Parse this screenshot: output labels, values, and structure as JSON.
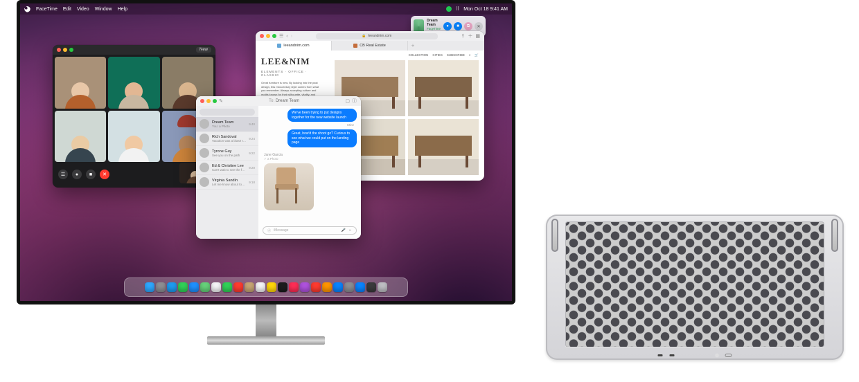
{
  "menubar": {
    "app": "FaceTime",
    "items": [
      "Edit",
      "Video",
      "Window",
      "Help"
    ],
    "clock": "Mon Oct 18  9:41 AM"
  },
  "control_banner": {
    "title": "Dream Team",
    "subtitle": "FaceTime Audio…",
    "buttons": {
      "mic": "mic",
      "video": "video",
      "share": "share",
      "leave": "leave"
    }
  },
  "facetime": {
    "new_label": "New",
    "controls": {
      "mute": "mute",
      "camera": "camera",
      "end": "end",
      "sidebar": "sidebar"
    },
    "tiles": [
      {
        "bg": "#d9c2a3",
        "shirt": "#b4602c",
        "head": "#e8c7a8",
        "wall": "#a99178"
      },
      {
        "bg": "#0f6f57",
        "shirt": "#c8b7a0",
        "head": "#e2b793",
        "wall": "#0f6f57"
      },
      {
        "bg": "#7a6d5a",
        "shirt": "#5a3a2c",
        "head": "#d9b58e",
        "wall": "#8a7c66"
      },
      {
        "bg": "#cfd8d3",
        "shirt": "#36454f",
        "head": "#eacba4",
        "wall": "#cfd8d3"
      },
      {
        "bg": "#d3e0e3",
        "shirt": "#f2f2f2",
        "head": "#f0c9a3",
        "wall": "#d3e0e3"
      },
      {
        "bg": "#8a98b8",
        "shirt": "#cd843b",
        "head": "#b8875c",
        "wall": "#8a98b8",
        "turban": "#a0392e"
      }
    ]
  },
  "messages": {
    "title": "Dream Team",
    "search_placeholder": "Search",
    "conversations": [
      {
        "name": "Dream Team",
        "preview": "You: a Photo",
        "time": "9:40"
      },
      {
        "name": "Rich Sandoval",
        "preview": "Vacation was a blast! I think my eyes for…",
        "time": "9:24"
      },
      {
        "name": "Tyrone Guy",
        "preview": "See you on the path",
        "time": "9:22"
      },
      {
        "name": "Ed & Christine Lee",
        "preview": "Can't wait to see the family!",
        "time": "9:20"
      },
      {
        "name": "Virginia Sandín",
        "preview": "Let me know about tonight",
        "time": "9:18"
      }
    ],
    "bubbles": [
      "We've been trying to put designs together for the new website launch",
      "Great, how'd the shoot go? Curious to see what we could put on the landing page"
    ],
    "stamp_label": "Mine",
    "sender": "Jane Garcia",
    "attachment_label": "a Photo",
    "input_placeholder": "iMessage"
  },
  "safari": {
    "address": "leeandnim.com",
    "tabs": [
      "leeandnim.com",
      "CB Real Estate"
    ],
    "nav": [
      "COLLECTION",
      "CITIES",
      "SUBSCRIBE"
    ],
    "brand": "LEE&NIM",
    "breadcrumbs": "ELEMENTS · OFFICE · CLASSIC",
    "copy": "Great furniture is new. By looking into the past design, this mid-century style comes from what you remember. Always accepting culture and motifs known for their silhouette, vitality, and designed to never look dated."
  },
  "dock": {
    "icons": [
      {
        "n": "finder",
        "c": "#2ea8ff"
      },
      {
        "n": "launchpad",
        "c": "#8e8e93"
      },
      {
        "n": "safari",
        "c": "#1e9bf0"
      },
      {
        "n": "messages",
        "c": "#31d158"
      },
      {
        "n": "mail",
        "c": "#1e90ff"
      },
      {
        "n": "maps",
        "c": "#66d17a"
      },
      {
        "n": "photos",
        "c": "#f5f5f7"
      },
      {
        "n": "facetime",
        "c": "#31d158"
      },
      {
        "n": "calendar",
        "c": "#ff3b30"
      },
      {
        "n": "contacts",
        "c": "#c7a574"
      },
      {
        "n": "reminders",
        "c": "#f5f5f7"
      },
      {
        "n": "notes",
        "c": "#ffd60a"
      },
      {
        "n": "tv",
        "c": "#1c1c1e"
      },
      {
        "n": "music",
        "c": "#ff2d55"
      },
      {
        "n": "podcasts",
        "c": "#af52de"
      },
      {
        "n": "news",
        "c": "#ff3b30"
      },
      {
        "n": "books",
        "c": "#ff9500"
      },
      {
        "n": "appstore",
        "c": "#0a84ff"
      },
      {
        "n": "settings",
        "c": "#8e8e93"
      },
      {
        "n": "keynote",
        "c": "#0a84ff"
      },
      {
        "n": "downloads",
        "c": "#3a3a3c"
      },
      {
        "n": "trash",
        "c": "#bfbfc4"
      }
    ]
  }
}
